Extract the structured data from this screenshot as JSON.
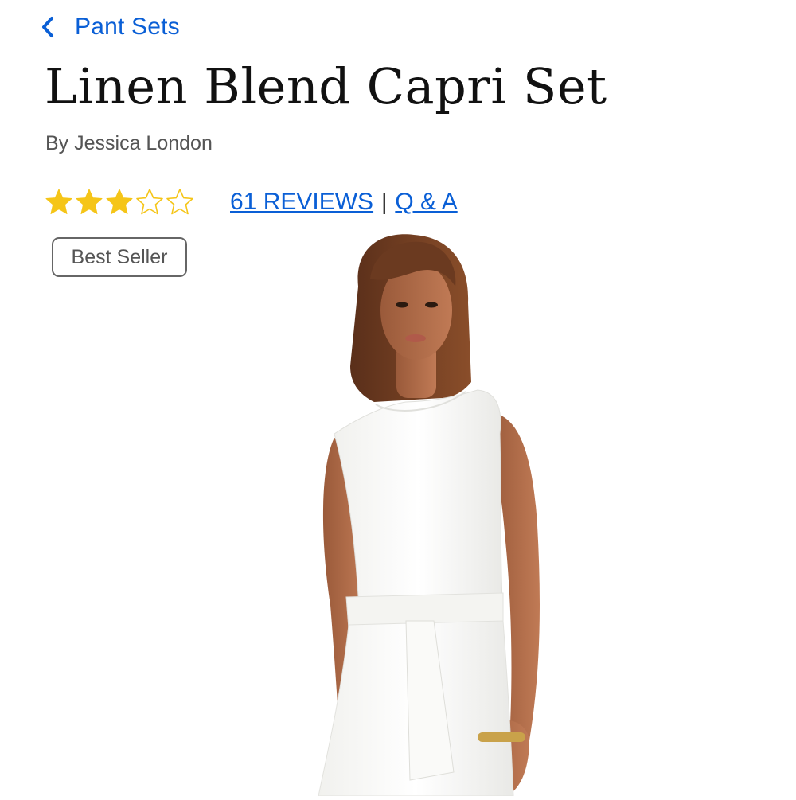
{
  "nav": {
    "back_label": "Pant Sets"
  },
  "product": {
    "title": "Linen Blend Capri Set",
    "brand": "By Jessica London",
    "rating": 3,
    "rating_max": 5,
    "reviews_label": "61 REVIEWS",
    "separator": "|",
    "qa_label": "Q & A",
    "badge": "Best Seller"
  },
  "image": {
    "alt": "Model wearing white sleeveless top with tie waist"
  },
  "colors": {
    "link": "#0a5fd6",
    "star_filled": "#f5c518",
    "text_muted": "#555555"
  },
  "icons": {
    "back": "chevron-left-icon",
    "star_filled": "star-filled-icon",
    "star_empty": "star-outline-icon"
  }
}
